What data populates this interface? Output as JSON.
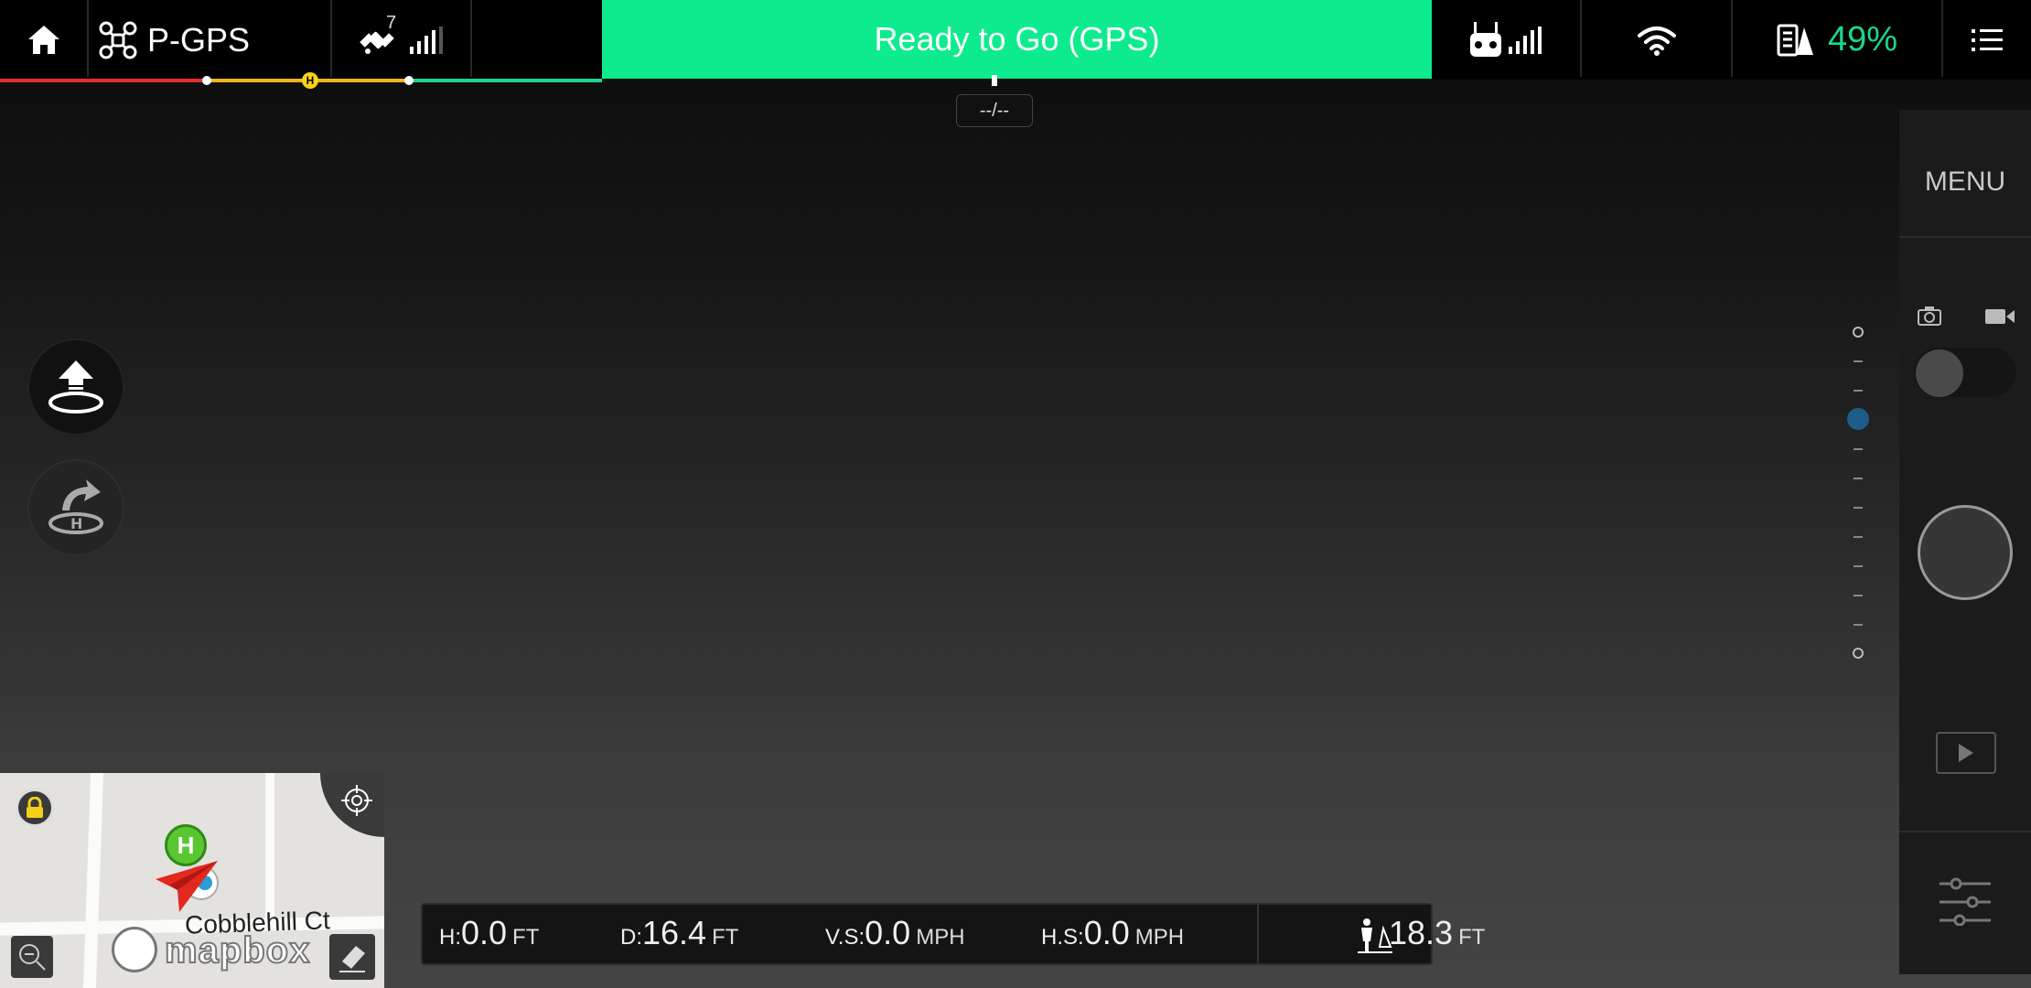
{
  "topbar": {
    "flight_mode": "P-GPS",
    "satellite_count": "7",
    "status": "Ready to Go (GPS)",
    "battery_percent": "49%",
    "colors": {
      "status_bg": "#0deb8e",
      "battery_text": "#18d98a"
    }
  },
  "flight_strip": {
    "distance_tag": "--/--",
    "home_marker": "H",
    "colors": {
      "low": "#e5302b",
      "mid": "#f0b61f",
      "ok": "#1cd68a"
    }
  },
  "left_buttons": {
    "takeoff_icon": "takeoff-icon",
    "return_home_icon": "return-home-icon"
  },
  "right_panel": {
    "menu_label": "MENU",
    "photo_icon": "camera-icon",
    "video_icon": "video-icon"
  },
  "map": {
    "street": "Cobblehill Ct",
    "provider": "mapbox",
    "home_pin": "H"
  },
  "telemetry": {
    "height": {
      "label": "H:",
      "value": "0.0",
      "unit": "FT"
    },
    "distance": {
      "label": "D:",
      "value": "16.4",
      "unit": "FT"
    },
    "vertical_speed": {
      "label": "V.S:",
      "value": "0.0",
      "unit": "MPH"
    },
    "horizontal_speed": {
      "label": "H.S:",
      "value": "0.0",
      "unit": "MPH"
    },
    "pilot_distance": {
      "value": "18.3",
      "unit": "FT"
    }
  }
}
